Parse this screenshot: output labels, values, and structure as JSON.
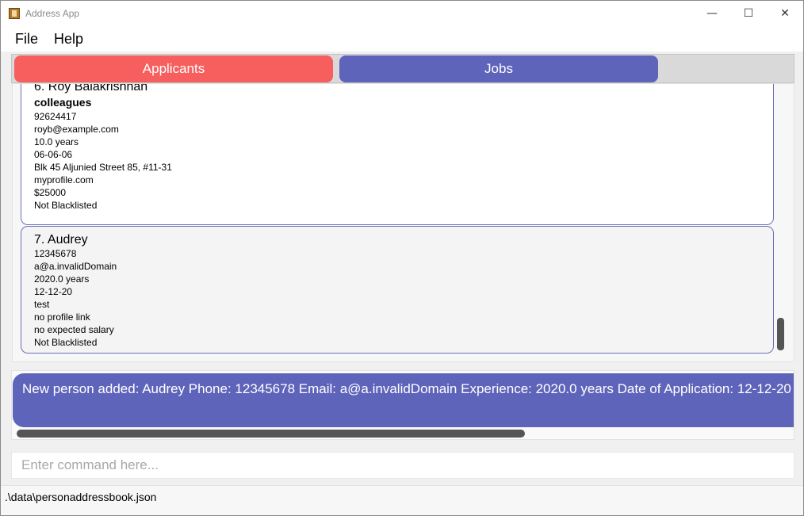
{
  "window": {
    "title": "Address App",
    "minimize_glyph": "—",
    "maximize_glyph": "☐",
    "close_glyph": "✕"
  },
  "menu": {
    "file": "File",
    "help": "Help"
  },
  "tabs": [
    {
      "label": "Applicants",
      "color": "#f65f5e"
    },
    {
      "label": "Jobs",
      "color": "#5f64bb"
    }
  ],
  "persons": [
    {
      "name": "6.  Roy Balakrishnan",
      "tag": "colleagues",
      "phone": "92624417",
      "email": "royb@example.com",
      "experience": "10.0 years",
      "date": "06-06-06",
      "address": "Blk 45 Aljunied Street 85, #11-31",
      "profile": "myprofile.com",
      "salary": "$25000",
      "blacklist": "Not Blacklisted"
    },
    {
      "name": "7.  Audrey",
      "phone": "12345678",
      "email": "a@a.invalidDomain",
      "experience": "2020.0 years",
      "date": "12-12-20",
      "address": "test",
      "profile": "no profile link",
      "salary": "no expected salary",
      "blacklist": "Not Blacklisted"
    }
  ],
  "result": {
    "text": "New person added: Audrey Phone: 12345678 Email: a@a.invalidDomain Experience: 2020.0 years Date of Application: 12-12-20"
  },
  "command": {
    "placeholder": "Enter command here...",
    "value": ""
  },
  "status": {
    "path": ".\\data\\personaddressbook.json"
  }
}
